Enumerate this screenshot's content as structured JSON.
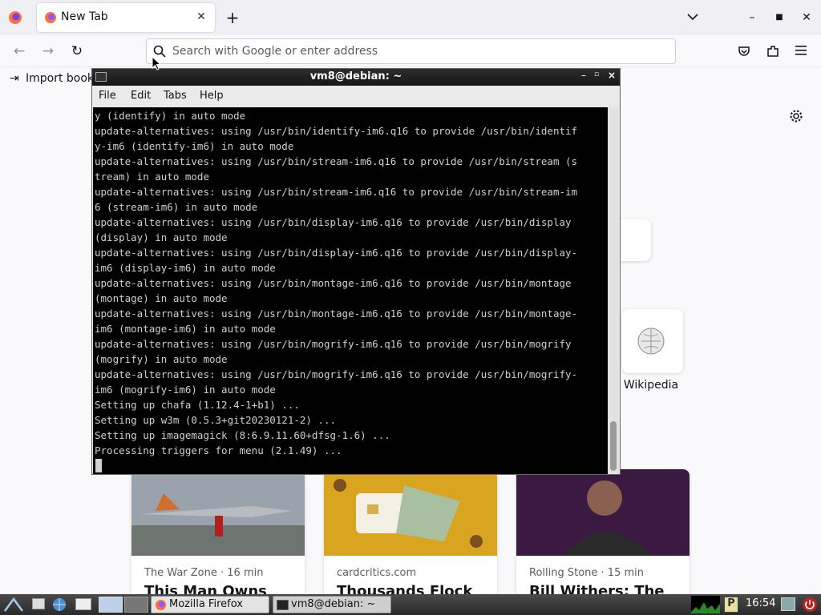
{
  "browser": {
    "tab_title": "New Tab",
    "url_placeholder": "Search with Google or enter address",
    "bookmark_import": "Import book"
  },
  "newtab": {
    "shortcut_wikipedia": "Wikipedia",
    "stories": [
      {
        "source": "The War Zone · 16 min",
        "headline": "This Man Owns"
      },
      {
        "source": "cardcritics.com",
        "headline": "Thousands Flock"
      },
      {
        "source": "Rolling Stone · 15 min",
        "headline": "Bill Withers: The"
      }
    ]
  },
  "terminal": {
    "title": "vm8@debian: ~",
    "menu": [
      "File",
      "Edit",
      "Tabs",
      "Help"
    ],
    "lines": [
      "y (identify) in auto mode",
      "update-alternatives: using /usr/bin/identify-im6.q16 to provide /usr/bin/identif",
      "y-im6 (identify-im6) in auto mode",
      "update-alternatives: using /usr/bin/stream-im6.q16 to provide /usr/bin/stream (s",
      "tream) in auto mode",
      "update-alternatives: using /usr/bin/stream-im6.q16 to provide /usr/bin/stream-im",
      "6 (stream-im6) in auto mode",
      "update-alternatives: using /usr/bin/display-im6.q16 to provide /usr/bin/display",
      "(display) in auto mode",
      "update-alternatives: using /usr/bin/display-im6.q16 to provide /usr/bin/display-",
      "im6 (display-im6) in auto mode",
      "update-alternatives: using /usr/bin/montage-im6.q16 to provide /usr/bin/montage",
      "(montage) in auto mode",
      "update-alternatives: using /usr/bin/montage-im6.q16 to provide /usr/bin/montage-",
      "im6 (montage-im6) in auto mode",
      "update-alternatives: using /usr/bin/mogrify-im6.q16 to provide /usr/bin/mogrify",
      "(mogrify) in auto mode",
      "update-alternatives: using /usr/bin/mogrify-im6.q16 to provide /usr/bin/mogrify-",
      "im6 (mogrify-im6) in auto mode",
      "Setting up chafa (1.12.4-1+b1) ...",
      "Setting up w3m (0.5.3+git20230121-2) ...",
      "Setting up imagemagick (8:6.9.11.60+dfsg-1.6) ...",
      "Processing triggers for menu (2.1.49) ..."
    ]
  },
  "taskbar": {
    "firefox_label": "Mozilla Firefox",
    "terminal_label": "vm8@debian: ~",
    "clock": "16:54"
  },
  "icons": [
    "firefox-icon",
    "close-icon",
    "plus-icon",
    "chevron-down-icon",
    "minimize-icon",
    "maximize-icon",
    "back-icon",
    "forward-icon",
    "reload-icon",
    "search-icon",
    "pocket-icon",
    "extensions-icon",
    "menu-icon",
    "import-icon",
    "gear-icon",
    "wikipedia-icon",
    "terminal-icon",
    "power-icon"
  ]
}
